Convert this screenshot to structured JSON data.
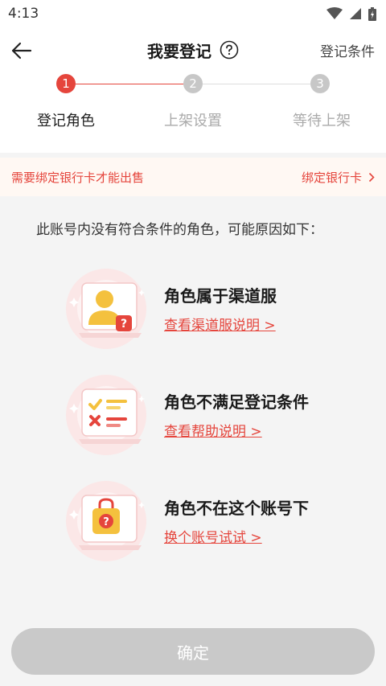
{
  "status_bar": {
    "time": "4:13"
  },
  "header": {
    "title": "我要登记",
    "conditions_link": "登记条件"
  },
  "steps": [
    {
      "number": "1",
      "label": "登记角色",
      "state": "active"
    },
    {
      "number": "2",
      "label": "上架设置",
      "state": "inactive"
    },
    {
      "number": "3",
      "label": "等待上架",
      "state": "inactive"
    }
  ],
  "notice": {
    "text": "需要绑定银行卡才能出售",
    "link": "绑定银行卡"
  },
  "reasons_intro": "此账号内没有符合条件的角色，可能原因如下：",
  "reasons": [
    {
      "title": "角色属于渠道服",
      "link": "查看渠道服说明 >",
      "icon": "user-question-icon"
    },
    {
      "title": "角色不满足登记条件",
      "link": "查看帮助说明 >",
      "icon": "checklist-icon"
    },
    {
      "title": "角色不在这个账号下",
      "link": "换个账号试试 >",
      "icon": "locked-question-icon"
    }
  ],
  "confirm_button": "确定",
  "colors": {
    "accent": "#e5453c",
    "inactive": "#c7c7c7",
    "button_disabled": "#c9c9c9",
    "notice_bg": "#fff8f3"
  }
}
